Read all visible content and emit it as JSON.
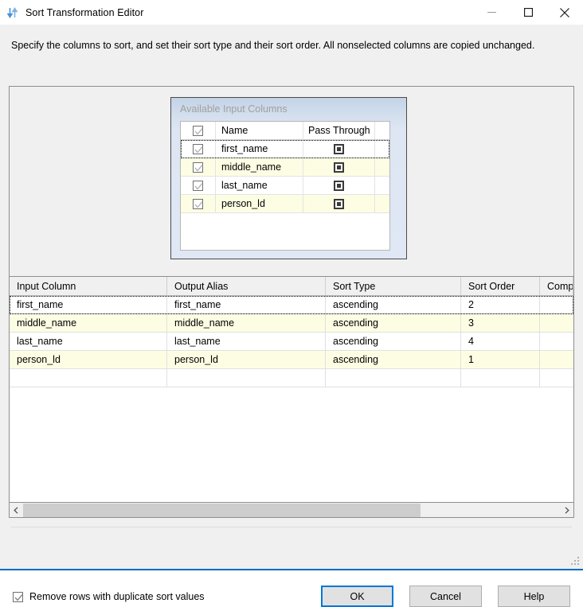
{
  "window": {
    "title": "Sort Transformation Editor",
    "icon": "sort-arrows-icon",
    "controls": {
      "minimize": "minimize-icon",
      "maximize": "maximize-icon",
      "close": "close-icon"
    },
    "accent_color": "#0078d7"
  },
  "description": "Specify the columns to sort, and set their sort type and their sort order. All nonselected columns are copied unchanged.",
  "available_input_columns": {
    "title": "Available Input Columns",
    "headers": {
      "check": "",
      "name": "Name",
      "pass_through": "Pass Through"
    },
    "header_checkbox_checked": true,
    "rows": [
      {
        "checked": true,
        "name": "first_name",
        "pass_through": "indeterminate"
      },
      {
        "checked": true,
        "name": "middle_name",
        "pass_through": "indeterminate"
      },
      {
        "checked": true,
        "name": "last_name",
        "pass_through": "indeterminate"
      },
      {
        "checked": true,
        "name": "person_ld",
        "pass_through": "indeterminate"
      }
    ]
  },
  "sort_grid": {
    "headers": [
      "Input Column",
      "Output Alias",
      "Sort Type",
      "Sort Order",
      "Compa"
    ],
    "rows": [
      {
        "input_column": "first_name",
        "output_alias": "first_name",
        "sort_type": "ascending",
        "sort_order": "2",
        "comparison": ""
      },
      {
        "input_column": "middle_name",
        "output_alias": "middle_name",
        "sort_type": "ascending",
        "sort_order": "3",
        "comparison": ""
      },
      {
        "input_column": "last_name",
        "output_alias": "last_name",
        "sort_type": "ascending",
        "sort_order": "4",
        "comparison": ""
      },
      {
        "input_column": "person_ld",
        "output_alias": "person_ld",
        "sort_type": "ascending",
        "sort_order": "1",
        "comparison": ""
      }
    ]
  },
  "scrollbar": {
    "left_arrow": "chevron-left-icon",
    "right_arrow": "chevron-right-icon",
    "thumb_percent": 74
  },
  "footer": {
    "duplicate_checkbox_label": "Remove rows with duplicate sort values",
    "duplicate_checkbox_checked": true,
    "ok_label": "OK",
    "cancel_label": "Cancel",
    "help_label": "Help"
  }
}
